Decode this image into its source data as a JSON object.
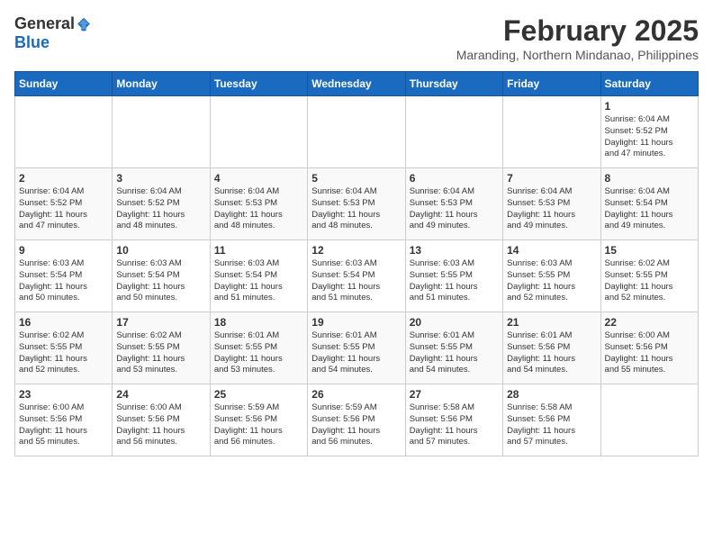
{
  "header": {
    "logo_general": "General",
    "logo_blue": "Blue",
    "month": "February 2025",
    "location": "Maranding, Northern Mindanao, Philippines"
  },
  "days_of_week": [
    "Sunday",
    "Monday",
    "Tuesday",
    "Wednesday",
    "Thursday",
    "Friday",
    "Saturday"
  ],
  "weeks": [
    [
      {
        "day": "",
        "info": ""
      },
      {
        "day": "",
        "info": ""
      },
      {
        "day": "",
        "info": ""
      },
      {
        "day": "",
        "info": ""
      },
      {
        "day": "",
        "info": ""
      },
      {
        "day": "",
        "info": ""
      },
      {
        "day": "1",
        "info": "Sunrise: 6:04 AM\nSunset: 5:52 PM\nDaylight: 11 hours\nand 47 minutes."
      }
    ],
    [
      {
        "day": "2",
        "info": "Sunrise: 6:04 AM\nSunset: 5:52 PM\nDaylight: 11 hours\nand 47 minutes."
      },
      {
        "day": "3",
        "info": "Sunrise: 6:04 AM\nSunset: 5:52 PM\nDaylight: 11 hours\nand 48 minutes."
      },
      {
        "day": "4",
        "info": "Sunrise: 6:04 AM\nSunset: 5:53 PM\nDaylight: 11 hours\nand 48 minutes."
      },
      {
        "day": "5",
        "info": "Sunrise: 6:04 AM\nSunset: 5:53 PM\nDaylight: 11 hours\nand 48 minutes."
      },
      {
        "day": "6",
        "info": "Sunrise: 6:04 AM\nSunset: 5:53 PM\nDaylight: 11 hours\nand 49 minutes."
      },
      {
        "day": "7",
        "info": "Sunrise: 6:04 AM\nSunset: 5:53 PM\nDaylight: 11 hours\nand 49 minutes."
      },
      {
        "day": "8",
        "info": "Sunrise: 6:04 AM\nSunset: 5:54 PM\nDaylight: 11 hours\nand 49 minutes."
      }
    ],
    [
      {
        "day": "9",
        "info": "Sunrise: 6:03 AM\nSunset: 5:54 PM\nDaylight: 11 hours\nand 50 minutes."
      },
      {
        "day": "10",
        "info": "Sunrise: 6:03 AM\nSunset: 5:54 PM\nDaylight: 11 hours\nand 50 minutes."
      },
      {
        "day": "11",
        "info": "Sunrise: 6:03 AM\nSunset: 5:54 PM\nDaylight: 11 hours\nand 51 minutes."
      },
      {
        "day": "12",
        "info": "Sunrise: 6:03 AM\nSunset: 5:54 PM\nDaylight: 11 hours\nand 51 minutes."
      },
      {
        "day": "13",
        "info": "Sunrise: 6:03 AM\nSunset: 5:55 PM\nDaylight: 11 hours\nand 51 minutes."
      },
      {
        "day": "14",
        "info": "Sunrise: 6:03 AM\nSunset: 5:55 PM\nDaylight: 11 hours\nand 52 minutes."
      },
      {
        "day": "15",
        "info": "Sunrise: 6:02 AM\nSunset: 5:55 PM\nDaylight: 11 hours\nand 52 minutes."
      }
    ],
    [
      {
        "day": "16",
        "info": "Sunrise: 6:02 AM\nSunset: 5:55 PM\nDaylight: 11 hours\nand 52 minutes."
      },
      {
        "day": "17",
        "info": "Sunrise: 6:02 AM\nSunset: 5:55 PM\nDaylight: 11 hours\nand 53 minutes."
      },
      {
        "day": "18",
        "info": "Sunrise: 6:01 AM\nSunset: 5:55 PM\nDaylight: 11 hours\nand 53 minutes."
      },
      {
        "day": "19",
        "info": "Sunrise: 6:01 AM\nSunset: 5:55 PM\nDaylight: 11 hours\nand 54 minutes."
      },
      {
        "day": "20",
        "info": "Sunrise: 6:01 AM\nSunset: 5:55 PM\nDaylight: 11 hours\nand 54 minutes."
      },
      {
        "day": "21",
        "info": "Sunrise: 6:01 AM\nSunset: 5:56 PM\nDaylight: 11 hours\nand 54 minutes."
      },
      {
        "day": "22",
        "info": "Sunrise: 6:00 AM\nSunset: 5:56 PM\nDaylight: 11 hours\nand 55 minutes."
      }
    ],
    [
      {
        "day": "23",
        "info": "Sunrise: 6:00 AM\nSunset: 5:56 PM\nDaylight: 11 hours\nand 55 minutes."
      },
      {
        "day": "24",
        "info": "Sunrise: 6:00 AM\nSunset: 5:56 PM\nDaylight: 11 hours\nand 56 minutes."
      },
      {
        "day": "25",
        "info": "Sunrise: 5:59 AM\nSunset: 5:56 PM\nDaylight: 11 hours\nand 56 minutes."
      },
      {
        "day": "26",
        "info": "Sunrise: 5:59 AM\nSunset: 5:56 PM\nDaylight: 11 hours\nand 56 minutes."
      },
      {
        "day": "27",
        "info": "Sunrise: 5:58 AM\nSunset: 5:56 PM\nDaylight: 11 hours\nand 57 minutes."
      },
      {
        "day": "28",
        "info": "Sunrise: 5:58 AM\nSunset: 5:56 PM\nDaylight: 11 hours\nand 57 minutes."
      },
      {
        "day": "",
        "info": ""
      }
    ]
  ]
}
